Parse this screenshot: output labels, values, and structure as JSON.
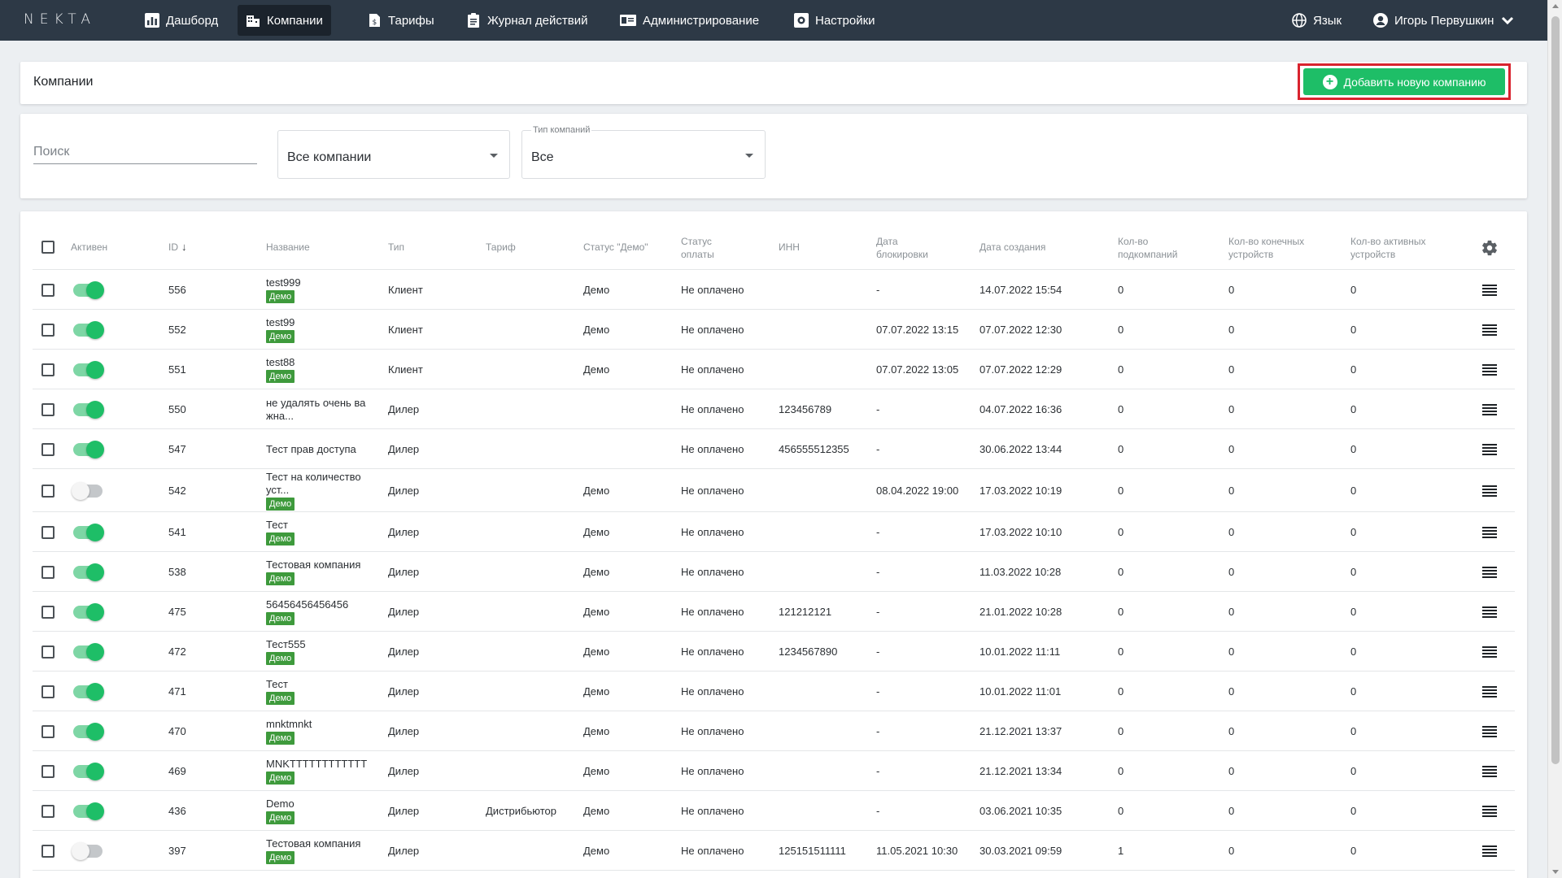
{
  "logo": "NEKTA",
  "nav": [
    {
      "label": "Дашборд",
      "icon": "chart-icon",
      "active": false
    },
    {
      "label": "Компании",
      "icon": "building-icon",
      "active": true
    },
    {
      "label": "Тарифы",
      "icon": "tariff-icon",
      "active": false
    },
    {
      "label": "Журнал действий",
      "icon": "clipboard-icon",
      "active": false
    },
    {
      "label": "Администрирование",
      "icon": "id-card-icon",
      "active": false
    },
    {
      "label": "Настройки",
      "icon": "gear-icon",
      "active": false
    }
  ],
  "language_label": "Язык",
  "user_name": "Игорь Первушкин",
  "page_title": "Компании",
  "add_button_label": "Добавить новую компанию",
  "filters": {
    "search_placeholder": "Поиск",
    "companies_select_value": "Все компании",
    "type_select_label": "Тип компаний",
    "type_select_value": "Все"
  },
  "columns": {
    "active": "Активен",
    "id": "ID",
    "name": "Название",
    "type": "Тип",
    "tariff": "Тариф",
    "demo_status": "Статус \"Демо\"",
    "payment_status": "Статус оплаты",
    "inn": "ИНН",
    "block_date": "Дата блокировки",
    "created": "Дата создания",
    "subcompanies": "Кол-во подкомпаний",
    "end_devices": "Кол-во конечных устройств",
    "active_devices": "Кол-во активных устройств"
  },
  "demo_badge": "Демо",
  "rows": [
    {
      "active": true,
      "id": "556",
      "name": "test999",
      "demo": true,
      "type": "Клиент",
      "tariff": "",
      "demo_status": "Демо",
      "payment": "Не оплачено",
      "inn": "",
      "block_date": "-",
      "created": "14.07.2022 15:54",
      "sub": "0",
      "end": "0",
      "act": "0"
    },
    {
      "active": true,
      "id": "552",
      "name": "test99",
      "demo": true,
      "type": "Клиент",
      "tariff": "",
      "demo_status": "Демо",
      "payment": "Не оплачено",
      "inn": "",
      "block_date": "07.07.2022 13:15",
      "created": "07.07.2022 12:30",
      "sub": "0",
      "end": "0",
      "act": "0"
    },
    {
      "active": true,
      "id": "551",
      "name": "test88",
      "demo": true,
      "type": "Клиент",
      "tariff": "",
      "demo_status": "Демо",
      "payment": "Не оплачено",
      "inn": "",
      "block_date": "07.07.2022 13:05",
      "created": "07.07.2022 12:29",
      "sub": "0",
      "end": "0",
      "act": "0"
    },
    {
      "active": true,
      "id": "550",
      "name": "не удалять очень ва жна...",
      "demo": false,
      "type": "Дилер",
      "tariff": "",
      "demo_status": "",
      "payment": "Не оплачено",
      "inn": "123456789",
      "block_date": "-",
      "created": "04.07.2022 16:36",
      "sub": "0",
      "end": "0",
      "act": "0"
    },
    {
      "active": true,
      "id": "547",
      "name": "Тест прав доступа",
      "demo": false,
      "type": "Дилер",
      "tariff": "",
      "demo_status": "",
      "payment": "Не оплачено",
      "inn": "456555512355",
      "block_date": "-",
      "created": "30.06.2022 13:44",
      "sub": "0",
      "end": "0",
      "act": "0"
    },
    {
      "active": false,
      "id": "542",
      "name": "Тест на количество уст...",
      "demo": true,
      "type": "Дилер",
      "tariff": "",
      "demo_status": "Демо",
      "payment": "Не оплачено",
      "inn": "",
      "block_date": "08.04.2022 19:00",
      "created": "17.03.2022 10:19",
      "sub": "0",
      "end": "0",
      "act": "0"
    },
    {
      "active": true,
      "id": "541",
      "name": "Тест",
      "demo": true,
      "type": "Дилер",
      "tariff": "",
      "demo_status": "Демо",
      "payment": "Не оплачено",
      "inn": "",
      "block_date": "-",
      "created": "17.03.2022 10:10",
      "sub": "0",
      "end": "0",
      "act": "0"
    },
    {
      "active": true,
      "id": "538",
      "name": "Тестовая компания",
      "demo": true,
      "type": "Дилер",
      "tariff": "",
      "demo_status": "Демо",
      "payment": "Не оплачено",
      "inn": "",
      "block_date": "-",
      "created": "11.03.2022 10:28",
      "sub": "0",
      "end": "0",
      "act": "0"
    },
    {
      "active": true,
      "id": "475",
      "name": "56456456456456",
      "demo": true,
      "type": "Дилер",
      "tariff": "",
      "demo_status": "Демо",
      "payment": "Не оплачено",
      "inn": "121212121",
      "block_date": "-",
      "created": "21.01.2022 10:28",
      "sub": "0",
      "end": "0",
      "act": "0"
    },
    {
      "active": true,
      "id": "472",
      "name": "Тест555",
      "demo": true,
      "type": "Дилер",
      "tariff": "",
      "demo_status": "Демо",
      "payment": "Не оплачено",
      "inn": "1234567890",
      "block_date": "-",
      "created": "10.01.2022 11:11",
      "sub": "0",
      "end": "0",
      "act": "0"
    },
    {
      "active": true,
      "id": "471",
      "name": "Тест",
      "demo": true,
      "type": "Дилер",
      "tariff": "",
      "demo_status": "Демо",
      "payment": "Не оплачено",
      "inn": "",
      "block_date": "-",
      "created": "10.01.2022 11:01",
      "sub": "0",
      "end": "0",
      "act": "0"
    },
    {
      "active": true,
      "id": "470",
      "name": "mnktmnkt",
      "demo": true,
      "type": "Дилер",
      "tariff": "",
      "demo_status": "Демо",
      "payment": "Не оплачено",
      "inn": "",
      "block_date": "-",
      "created": "21.12.2021 13:37",
      "sub": "0",
      "end": "0",
      "act": "0"
    },
    {
      "active": true,
      "id": "469",
      "name": "MNKTTTTTTTTTTTT",
      "demo": true,
      "type": "Дилер",
      "tariff": "",
      "demo_status": "Демо",
      "payment": "Не оплачено",
      "inn": "",
      "block_date": "-",
      "created": "21.12.2021 13:34",
      "sub": "0",
      "end": "0",
      "act": "0"
    },
    {
      "active": true,
      "id": "436",
      "name": "Demo",
      "demo": true,
      "type": "Дилер",
      "tariff": "Дистрибьютор",
      "demo_status": "Демо",
      "payment": "Не оплачено",
      "inn": "",
      "block_date": "-",
      "created": "03.06.2021 10:35",
      "sub": "0",
      "end": "0",
      "act": "0"
    },
    {
      "active": false,
      "id": "397",
      "name": "Тестовая компания",
      "demo": true,
      "type": "Дилер",
      "tariff": "",
      "demo_status": "Демо",
      "payment": "Не оплачено",
      "inn": "125151511111",
      "block_date": "11.05.2021 10:30",
      "created": "30.03.2021 09:59",
      "sub": "1",
      "end": "0",
      "act": "0"
    }
  ],
  "colors": {
    "topbar": "#2d3946",
    "accent_green": "#1ebe67",
    "demo_badge": "#3e9a3c",
    "highlight_red": "#d9232e"
  }
}
